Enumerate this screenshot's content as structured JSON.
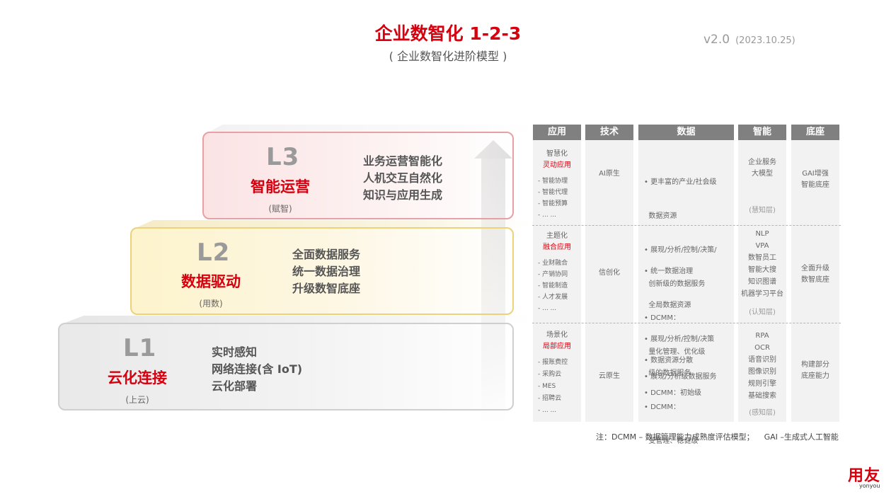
{
  "header": {
    "title": "企业数智化 1-2-3",
    "subtitle": "( 企业数智化进阶模型 )",
    "version": "v2.0",
    "version_date": "(2023.10.25)"
  },
  "levels": [
    {
      "code": "L3",
      "name": "智能运营",
      "sub": "(赋智)",
      "features": [
        "业务运营智能化",
        "人机交互自然化",
        "知识与应用生成"
      ]
    },
    {
      "code": "L2",
      "name": "数据驱动",
      "sub": "(用数)",
      "features": [
        "全面数据服务",
        "统一数据治理",
        "升级数智底座"
      ]
    },
    {
      "code": "L1",
      "name": "云化连接",
      "sub": "(上云)",
      "features": [
        "实时感知",
        "网络连接(含 IoT)",
        "云化部署"
      ]
    }
  ],
  "table": {
    "headers": [
      "应用",
      "技术",
      "数据",
      "智能",
      "底座"
    ],
    "rows": [
      {
        "app_title": "智慧化",
        "app_red": "灵动应用",
        "app_items": [
          "- 智能协理",
          "- 智能代理",
          "- 智能预算",
          "- ... ..."
        ],
        "tech": "AI原生",
        "data": [
          "• 更丰富的产业/社会级",
          "  数据资源",
          "• 展现/分析/控制/决策/",
          "  创新级的数据服务",
          "• DCMM：",
          "  量化管理、优化级"
        ],
        "ai_items": [
          "企业服务",
          "大模型"
        ],
        "ai_layer": "(慧知层)",
        "base": [
          "GAI增强",
          "智能底座"
        ]
      },
      {
        "app_title": "主题化",
        "app_red": "融合应用",
        "app_items": [
          "- 业财融合",
          "- 产销协同",
          "- 智能制造",
          "- 人才发展",
          "- ... ..."
        ],
        "tech": "信创化",
        "data": [
          "• 统一数据治理",
          "  全局数据资源",
          "• 展现/分析/控制/决策",
          "  级的数据服务",
          "• DCMM：",
          "  受管理、稳健级"
        ],
        "ai_items": [
          "NLP",
          "VPA",
          "数智员工",
          "智能大搜",
          "知识图谱",
          "机器学习平台"
        ],
        "ai_layer": "(认知层)",
        "base": [
          "全面升级",
          "数智底座"
        ]
      },
      {
        "app_title": "场景化",
        "app_red": "局部应用",
        "app_items": [
          "- 报账费控",
          "- 采购云",
          "- MES",
          "- 招聘云",
          "- ... ..."
        ],
        "tech": "云原生",
        "data": [
          "• 数据资源分散",
          "• 展现/分析级数据服务",
          "• DCMM：初始级"
        ],
        "ai_items": [
          "RPA",
          "OCR",
          "语音识别",
          "图像识别",
          "规则引擎",
          "基础搜索"
        ],
        "ai_layer": "(感知层)",
        "base": [
          "构建部分",
          "底座能力"
        ]
      }
    ]
  },
  "note": "注：DCMM – 数据管理能力成熟度评估模型；    GAI –生成式人工智能",
  "logo": {
    "name": "用友",
    "sub": "yonyou"
  },
  "colors": {
    "brand_red": "#d7000f",
    "header_gray": "#808080",
    "cell_bg": "#f2f2f2"
  }
}
